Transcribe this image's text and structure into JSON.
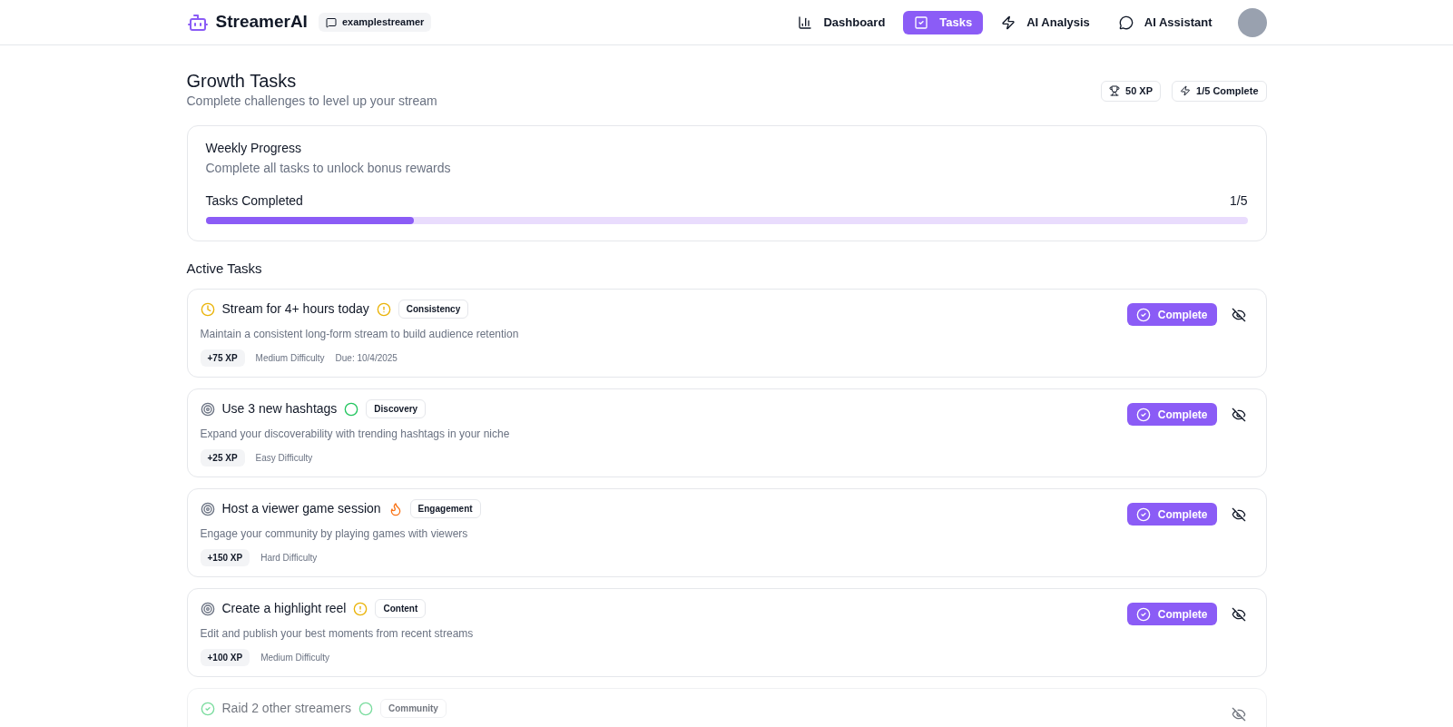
{
  "header": {
    "brand": "StreamerAI",
    "channel": "examplestreamer",
    "nav": [
      {
        "label": "Dashboard",
        "selected": false
      },
      {
        "label": "Tasks",
        "selected": true
      },
      {
        "label": "AI Analysis",
        "selected": false
      },
      {
        "label": "AI Assistant",
        "selected": false
      }
    ]
  },
  "page": {
    "title": "Growth Tasks",
    "subtitle": "Complete challenges to level up your stream",
    "badges": [
      {
        "label": "50 XP"
      },
      {
        "label": "1/5 Complete"
      }
    ]
  },
  "progress_card": {
    "title": "Weekly Progress",
    "subtitle": "Complete all tasks to unlock bonus rewards",
    "label": "Tasks Completed",
    "reading": "1/5",
    "level": 0.2
  },
  "active_tasks": {
    "heading": "Active Tasks",
    "tasks": [
      {
        "title": "Stream for 4+ hours today",
        "kind": "in_progress",
        "difficulty_icon": {
          "kind": "medium"
        },
        "category": "Consistency",
        "description": "Maintain a consistent long-form stream to build audience retention",
        "xp": "+75 XP",
        "difficulty_label": "Medium Difficulty",
        "due": "Due: 10/4/2025",
        "button": "Complete"
      },
      {
        "title": "Use 3 new hashtags",
        "kind": "pending",
        "difficulty_icon": {
          "kind": "easy"
        },
        "category": "Discovery",
        "description": "Expand your discoverability with trending hashtags in your niche",
        "xp": "+25 XP",
        "difficulty_label": "Easy Difficulty",
        "button": "Complete"
      },
      {
        "title": "Host a viewer game session",
        "kind": "pending",
        "difficulty_icon": {
          "kind": "hard"
        },
        "category": "Engagement",
        "description": "Engage your community by playing games with viewers",
        "xp": "+150 XP",
        "difficulty_label": "Hard Difficulty",
        "button": "Complete"
      },
      {
        "title": "Create a highlight reel",
        "kind": "pending",
        "difficulty_icon": {
          "kind": "medium"
        },
        "category": "Content",
        "description": "Edit and publish your best moments from recent streams",
        "xp": "+100 XP",
        "difficulty_label": "Medium Difficulty",
        "button": "Complete"
      },
      {
        "title": "Raid 2 other streamers",
        "kind": "completed",
        "difficulty_icon": {
          "kind": "easy"
        },
        "category": "Community"
      }
    ]
  }
}
